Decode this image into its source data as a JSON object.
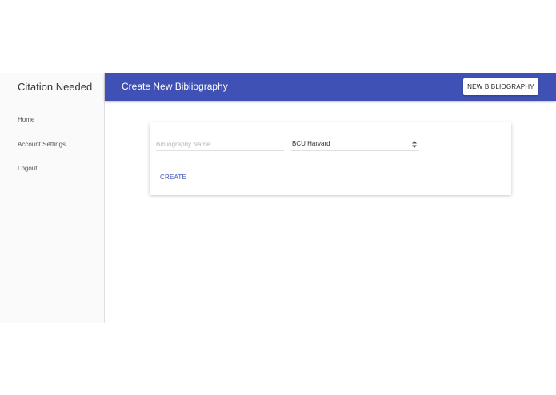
{
  "sidebar": {
    "brand": "Citation Needed",
    "items": [
      {
        "label": "Home"
      },
      {
        "label": "Account Settings"
      },
      {
        "label": "Logout"
      }
    ]
  },
  "header": {
    "title": "Create New Bibliography",
    "new_button_label": "NEW BIBLIOGRAPHY",
    "color": "#3f51b5"
  },
  "form": {
    "name_placeholder": "Bibliography Name",
    "name_value": "",
    "style_selected": "BCU Harvard",
    "style_icon": "updown-chevron-icon",
    "create_label": "CREATE"
  }
}
